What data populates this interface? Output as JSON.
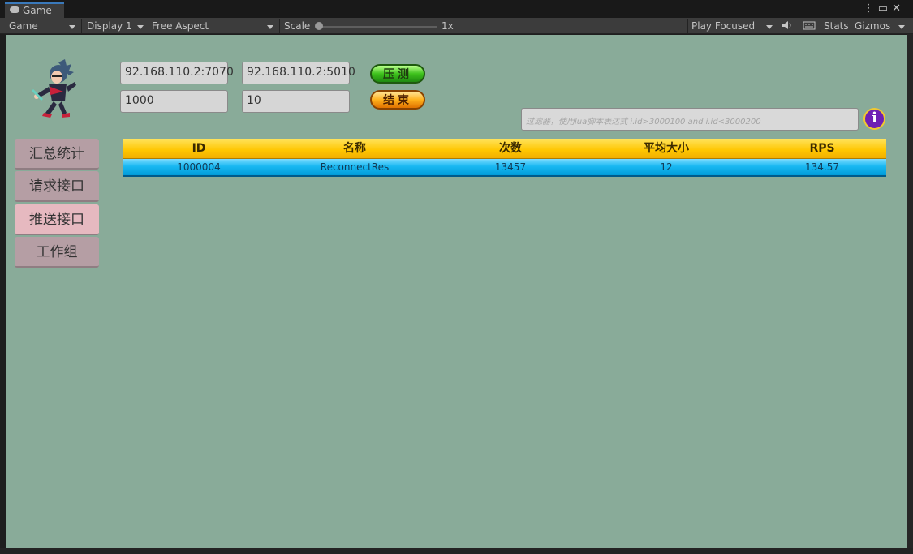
{
  "window": {
    "tab_label": "Game",
    "controls": [
      "⋮",
      "▭",
      "✕"
    ]
  },
  "toolbar": {
    "view_mode": "Game",
    "display": "Display 1",
    "aspect": "Free Aspect",
    "scale_label": "Scale",
    "scale_value": "1x",
    "play_mode": "Play Focused",
    "stats_label": "Stats",
    "gizmos_label": "Gizmos"
  },
  "connection": {
    "server_1": "92.168.110.2:7070",
    "server_2": "92.168.110.2:5010",
    "count": "1000",
    "concurrency": "10"
  },
  "actions": {
    "start_label": "压测",
    "stop_label": "结束"
  },
  "filter": {
    "placeholder": "过滤器，使用lua脚本表达式      i.id>3000100 and i.id<3000200"
  },
  "sidebar": {
    "items": [
      {
        "label": "汇总统计"
      },
      {
        "label": "请求接口"
      },
      {
        "label": "推送接口"
      },
      {
        "label": "工作组"
      }
    ]
  },
  "table": {
    "headers": [
      "ID",
      "名称",
      "次数",
      "平均大小",
      "RPS"
    ],
    "rows": [
      [
        "1000004",
        "ReconnectRes",
        "13457",
        "12",
        "134.57"
      ]
    ]
  },
  "colors": {
    "game_bg": "#89ab99",
    "header_yellow": "#ffc600",
    "row_blue": "#19b8f2",
    "sidebar_active": "#e6b9c0",
    "sidebar_inactive": "#b59ea4"
  }
}
